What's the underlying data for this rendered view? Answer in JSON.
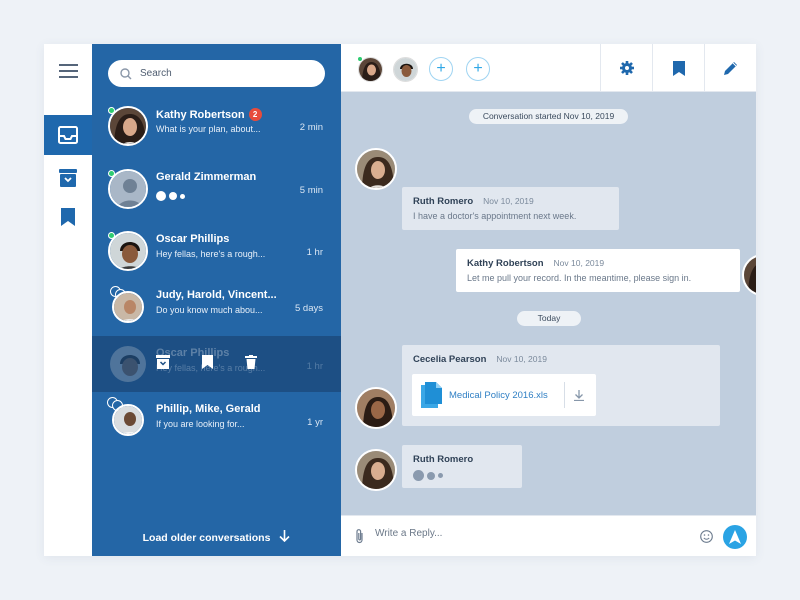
{
  "search": {
    "placeholder": "Search"
  },
  "conversations": [
    {
      "name": "Kathy Robertson",
      "preview": "What is your plan, about...",
      "time": "2 min",
      "badge": "2"
    },
    {
      "name": "Gerald Zimmerman",
      "preview": "",
      "time": "5 min"
    },
    {
      "name": "Oscar Phillips",
      "preview": "Hey fellas, here's a rough...",
      "time": "1 hr"
    },
    {
      "name": "Judy, Harold, Vincent...",
      "preview": "Do you know much abou...",
      "time": "5 days"
    },
    {
      "name": "Oscar Phillips",
      "preview": "Hey fellas, here's a rough...",
      "time": "1 hr"
    },
    {
      "name": "Phillip, Mike, Gerald",
      "preview": "If you are looking for...",
      "time": "1 yr"
    }
  ],
  "load_older": "Load older conversations",
  "chat": {
    "started": "Conversation started Nov 10, 2019",
    "today": "Today",
    "messages": [
      {
        "name": "Ruth Romero",
        "date": "Nov 10, 2019",
        "text": "I have a doctor's appointment next week."
      },
      {
        "name": "Kathy Robertson",
        "date": "Nov 10, 2019",
        "text": "Let me pull your record. In the meantime, please sign in."
      },
      {
        "name": "Cecelia Pearson",
        "date": "Nov 10, 2019",
        "file": "Medical Policy 2016.xls"
      },
      {
        "name": "Ruth Romero"
      }
    ]
  },
  "reply": {
    "placeholder": "Write a Reply..."
  },
  "icons": {
    "menu": "menu-icon",
    "inbox": "inbox-icon",
    "archive": "archive-icon",
    "bookmark": "bookmark-icon",
    "settings": "gear-icon",
    "edit": "pencil-icon",
    "attach": "paperclip-icon",
    "emoji": "smiley-icon",
    "send": "send-icon",
    "download": "download-icon",
    "file": "document-icon",
    "delete": "trash-icon"
  },
  "colors": {
    "sidebar": "#2466a6",
    "active_rail": "#1f68ad",
    "chat_bg": "#c0cede",
    "badge": "#e74c3c",
    "online": "#2ecc71",
    "accent": "#2aa3e4"
  }
}
